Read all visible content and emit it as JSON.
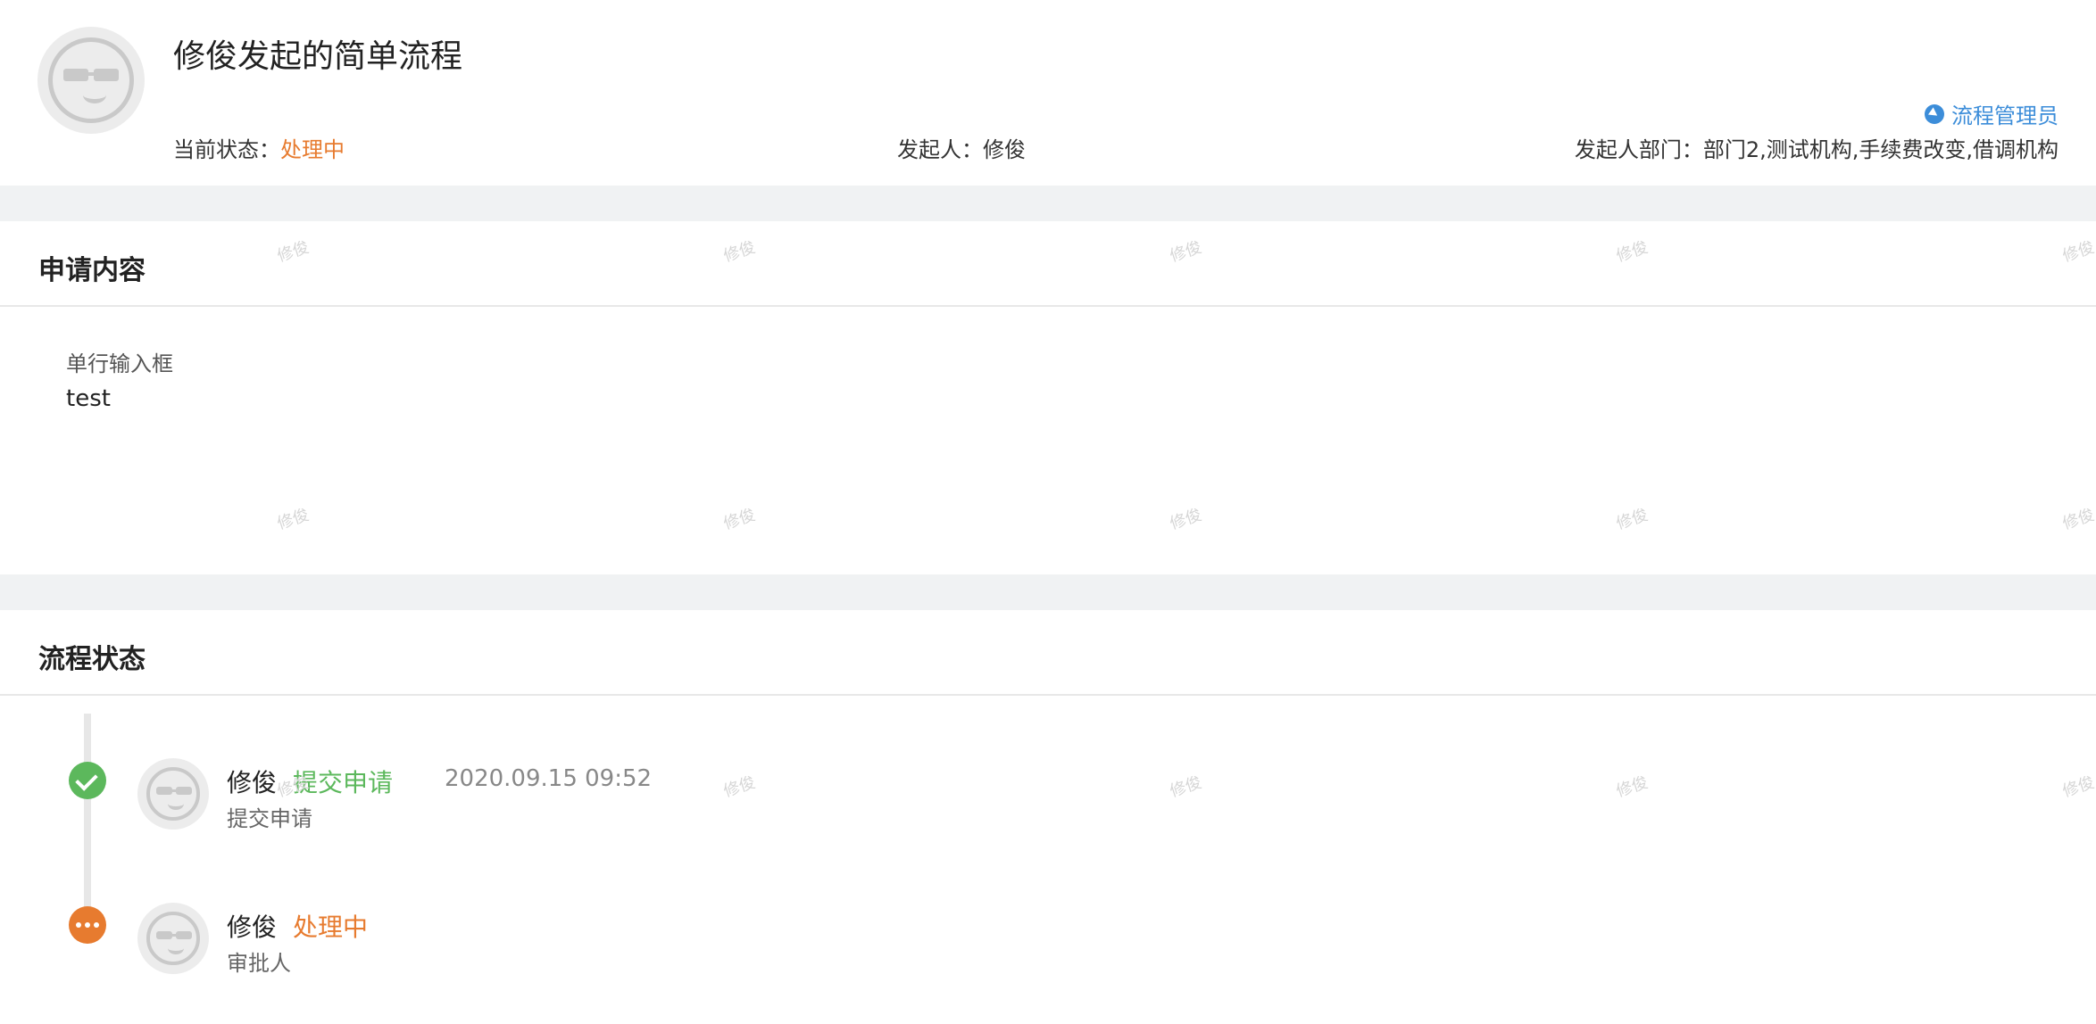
{
  "header": {
    "title": "修俊发起的简单流程",
    "admin_link": "流程管理员",
    "status_label": "当前状态：",
    "status_value": "处理中",
    "initiator_label": "发起人：",
    "initiator_value": "修俊",
    "dept_label": "发起人部门：",
    "dept_value": "部门2,测试机构,手续费改变,借调机构"
  },
  "application": {
    "section_title": "申请内容",
    "field_label": "单行输入框",
    "field_value": "test"
  },
  "process": {
    "section_title": "流程状态",
    "steps": [
      {
        "name": "修俊",
        "action": "提交申请",
        "time": "2020.09.15 09:52",
        "sub": "提交申请",
        "status": "done"
      },
      {
        "name": "修俊",
        "action": "处理中",
        "time": "",
        "sub": "审批人",
        "status": "pending"
      }
    ]
  },
  "watermark": "修俊",
  "colors": {
    "accent_orange": "#e77b2f",
    "accent_green": "#5cb85c",
    "link_blue": "#3c8dd9",
    "gap_gray": "#f0f2f3"
  }
}
